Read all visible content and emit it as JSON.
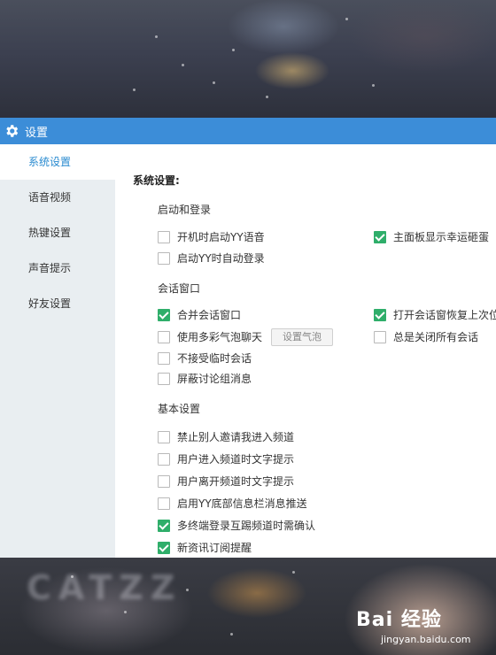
{
  "window": {
    "title": "设置",
    "icon": "gear-icon"
  },
  "sidebar": {
    "items": [
      {
        "label": "系统设置",
        "active": true
      },
      {
        "label": "语音视频",
        "active": false
      },
      {
        "label": "热键设置",
        "active": false
      },
      {
        "label": "声音提示",
        "active": false
      },
      {
        "label": "好友设置",
        "active": false
      }
    ]
  },
  "content": {
    "heading": "系统设置:",
    "groups": [
      {
        "title": "启动和登录",
        "options": [
          {
            "label": "开机时启动YY语音",
            "checked": false
          },
          {
            "label": "主面板显示幸运砸蛋",
            "checked": true
          },
          {
            "label": "启动YY时自动登录",
            "checked": false
          }
        ]
      },
      {
        "title": "会话窗口",
        "options": [
          {
            "label": "合并会话窗口",
            "checked": true
          },
          {
            "label": "打开会话窗恢复上次位",
            "checked": true
          },
          {
            "label": "使用多彩气泡聊天",
            "checked": false
          },
          {
            "label": "总是关闭所有会话",
            "checked": false
          },
          {
            "label": "不接受临时会话",
            "checked": false
          },
          {
            "label": "屏蔽讨论组消息",
            "checked": false
          }
        ],
        "bubble_button": "设置气泡"
      },
      {
        "title": "基本设置",
        "options": [
          {
            "label": "禁止别人邀请我进入频道",
            "checked": false
          },
          {
            "label": "用户进入频道时文字提示",
            "checked": false
          },
          {
            "label": "用户离开频道时文字提示",
            "checked": false
          },
          {
            "label": "启用YY底部信息栏消息推送",
            "checked": false
          },
          {
            "label": "多终端登录互踢频道时需确认",
            "checked": true
          },
          {
            "label": "新资讯订阅提醒",
            "checked": true
          }
        ]
      }
    ]
  },
  "watermark": {
    "main": "Bai 经验",
    "sub": "jingyan.baidu.com"
  },
  "colors": {
    "titlebar": "#3c8dd8",
    "sidebar_bg": "#e9eef1",
    "active_nav": "#2a8bd0",
    "checked": "#2fae6a"
  }
}
